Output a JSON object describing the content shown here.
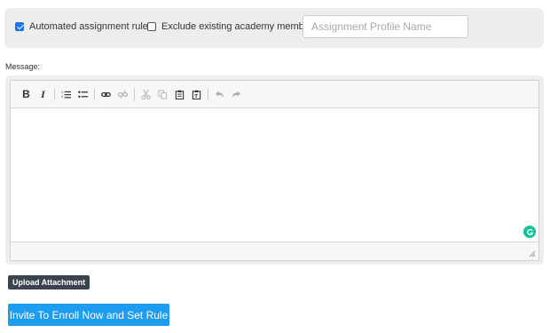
{
  "options": {
    "automated_rule": {
      "label": "Automated assignment rule",
      "checked": true
    },
    "exclude_members": {
      "label": "Exclude existing academy members",
      "checked": false
    },
    "profile_name": {
      "placeholder": "Assignment Profile Name",
      "value": ""
    }
  },
  "message": {
    "label": "Message:",
    "toolbar": [
      {
        "icon": "bold-icon",
        "enabled": true
      },
      {
        "icon": "italic-icon",
        "enabled": true
      },
      {
        "icon": "numbered-list-icon",
        "enabled": true
      },
      {
        "icon": "bulleted-list-icon",
        "enabled": true
      },
      {
        "icon": "link-icon",
        "enabled": true
      },
      {
        "icon": "unlink-icon",
        "enabled": false
      },
      {
        "icon": "cut-icon",
        "enabled": false
      },
      {
        "icon": "copy-icon",
        "enabled": false
      },
      {
        "icon": "paste-icon",
        "enabled": true
      },
      {
        "icon": "paste-text-icon",
        "enabled": true
      },
      {
        "icon": "undo-icon",
        "enabled": false
      },
      {
        "icon": "redo-icon",
        "enabled": false
      }
    ],
    "body": ""
  },
  "actions": {
    "upload_label": "Upload Attachment",
    "enroll_label": "Invite To Enroll Now and Set Rule"
  },
  "colors": {
    "primary": "#1e9cf0",
    "dark_button": "#3b444d",
    "panel_bg": "#ebedef",
    "grammarly": "#15c39a"
  }
}
